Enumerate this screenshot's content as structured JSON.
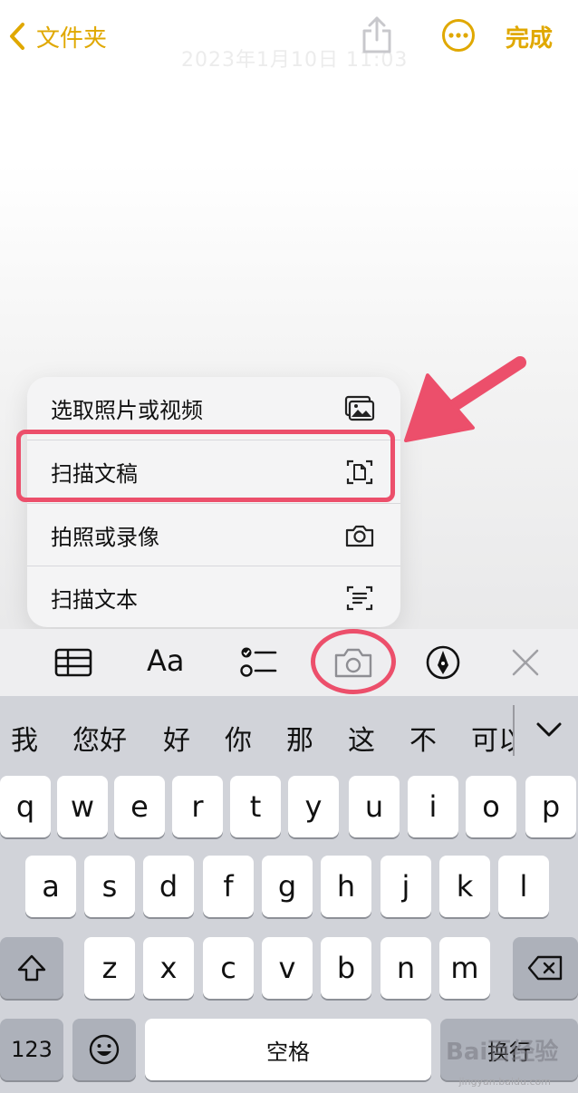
{
  "nav": {
    "back_label": "文件夹",
    "done_label": "完成",
    "faded_date": "2023年1月10日 11:03"
  },
  "menu": {
    "items": [
      {
        "label": "选取照片或视频",
        "icon": "photo-library-icon"
      },
      {
        "label": "扫描文稿",
        "icon": "scan-document-icon"
      },
      {
        "label": "拍照或录像",
        "icon": "camera-icon"
      },
      {
        "label": "扫描文本",
        "icon": "scan-text-icon"
      }
    ]
  },
  "toolbar": {
    "format_label": "Aa",
    "icons": [
      "table-icon",
      "format-icon",
      "checklist-icon",
      "camera-icon",
      "markup-icon",
      "close-icon"
    ]
  },
  "keyboard": {
    "candidates": [
      "我",
      "您好",
      "好",
      "你",
      "那",
      "这",
      "不",
      "可以"
    ],
    "row1": [
      "q",
      "w",
      "e",
      "r",
      "t",
      "y",
      "u",
      "i",
      "o",
      "p"
    ],
    "row2": [
      "a",
      "s",
      "d",
      "f",
      "g",
      "h",
      "j",
      "k",
      "l"
    ],
    "row3": [
      "z",
      "x",
      "c",
      "v",
      "b",
      "n",
      "m"
    ],
    "numbers_label": "123",
    "space_label": "空格",
    "return_label": "换行"
  },
  "watermark": {
    "brand": "Bai百经验",
    "url": "jingyan.baidu.com"
  },
  "colors": {
    "accent": "#e0a800",
    "annotation": "#ec4f6b",
    "keyboard_bg": "#d1d3d9"
  }
}
